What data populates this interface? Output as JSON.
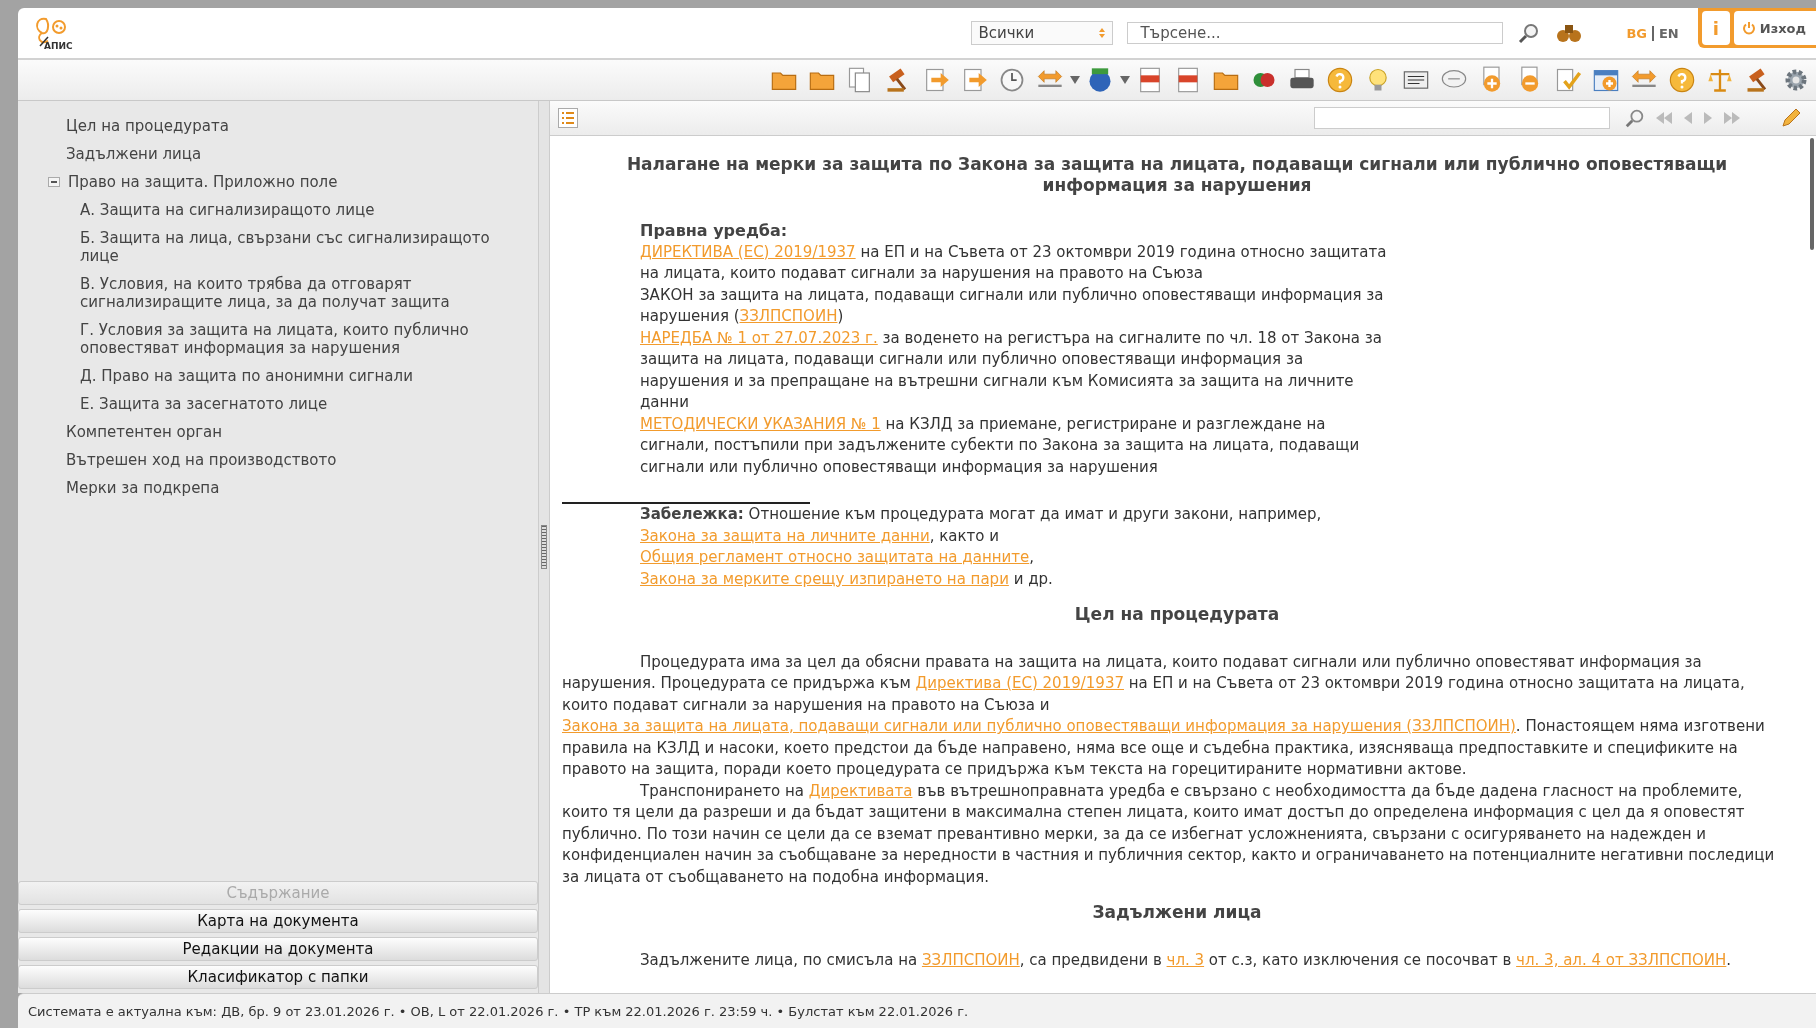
{
  "header": {
    "logo_text": "АПИС",
    "scope_select": "Всички",
    "search": {
      "placeholder": "Търсене..."
    },
    "languages": [
      {
        "label": "BG",
        "selected": true
      },
      {
        "label": "EN",
        "selected": false
      }
    ],
    "info_button": "i",
    "logout_button": "Изход"
  },
  "sidebar": {
    "outline": [
      {
        "label": "Цел на процедурата"
      },
      {
        "label": "Задължени лица"
      },
      {
        "label": "Право на защита. Приложно поле",
        "expanded": true,
        "children": [
          {
            "label": "А. Защита на сигнализиращото лице"
          },
          {
            "label": "Б. Защита на лица, свързани със сигнализиращото лице"
          },
          {
            "label": "В. Условия, на които трябва да отговарят сигнализиращите лица, за да получат защита"
          },
          {
            "label": "Г. Условия за защита на лицата, които публично оповестяват информация за нарушения"
          },
          {
            "label": "Д. Право на защита по анонимни сигнали"
          },
          {
            "label": "Е. Защита за засегнатото лице"
          }
        ]
      },
      {
        "label": "Компетентен орган"
      },
      {
        "label": "Вътрешен ход на производството"
      },
      {
        "label": "Мерки за подкрепа"
      }
    ],
    "panels": [
      {
        "label": "Съдържание",
        "selected": true
      },
      {
        "label": "Карта на документа",
        "selected": false
      },
      {
        "label": "Редакции на документа",
        "selected": false
      },
      {
        "label": "Класификатор с папки",
        "selected": false
      }
    ]
  },
  "document": {
    "title": "Налагане на мерки за защита по Закона за защита на лицата, подаващи сигнали или публично оповестяващи информация за нарушения",
    "legal_basis": {
      "heading": "Правна уредба:",
      "entries": [
        [
          {
            "text": "ДИРЕКТИВА (ЕС) 2019/1937",
            "link": true
          },
          {
            "text": " на ЕП и на Съвета от 23 октомври 2019 година относно защитата на лицата, които подават сигнали за нарушения на правото на Съюза",
            "link": false
          }
        ],
        [
          {
            "text": "ЗАКОН за защита на лицата, подаващи сигнали или публично оповестяващи информация за нарушения (",
            "link": false
          },
          {
            "text": "ЗЗЛПСПОИН",
            "link": true
          },
          {
            "text": ")",
            "link": false
          }
        ],
        [
          {
            "text": "НАРЕДБА № 1 от 27.07.2023 г.",
            "link": true
          },
          {
            "text": " за воденето на регистъра на сигналите по чл. 18 от Закона за защита на лицата, подаващи сигнали или публично оповестяващи информация за нарушения и за препращане на вътрешни сигнали към Комисията за защита на личните данни",
            "link": false
          }
        ],
        [
          {
            "text": "МЕТОДИЧЕСКИ УКАЗАНИЯ № 1",
            "link": true
          },
          {
            "text": " на КЗЛД за приемане, регистриране и разглеждане на сигнали, постъпили при задължените субекти по Закона за защита на лицата, подаващи сигнали или публично оповестяващи информация за нарушения",
            "link": false
          }
        ]
      ]
    },
    "note": {
      "label": "Забележка:",
      "segments": [
        {
          "text": " Отношение към процедурата могат да имат и други закони, например, ",
          "link": false
        },
        {
          "text": "Закона за защита на личните данни",
          "link": true
        },
        {
          "text": ", както и ",
          "link": false
        },
        {
          "text": "Общия регламент относно защитата на данните",
          "link": true
        },
        {
          "text": ", ",
          "link": false
        },
        {
          "text": "Закона за мерките срещу изпирането на пари",
          "link": true
        },
        {
          "text": " и др.",
          "link": false
        }
      ]
    },
    "sections": [
      {
        "heading": "Цел на процедурата",
        "paragraphs": [
          [
            {
              "text": "Процедурата има за цел да обясни правата на защита на лицата, които подават сигнали или публично оповестяват информация за нарушения. Процедурата се придържа към ",
              "link": false
            },
            {
              "text": "Директива (ЕС) 2019/1937",
              "link": true
            },
            {
              "text": " на ЕП и на Съвета от 23 октомври 2019 година относно защитата на лицата, които подават сигнали за нарушения на правото на Съюза и ",
              "link": false
            },
            {
              "text": "Закона за защита на лицата, подаващи сигнали или публично оповестяващи информация за нарушения (ЗЗЛПСПОИН)",
              "link": true
            },
            {
              "text": ". Понастоящем няма изготвени правила на КЗЛД и насоки, което предстои да бъде направено, няма все още и съдебна практика, изясняваща предпоставките и спецификите на правото на защита, поради което процедурата се придържа към текста на горецитираните нормативни актове.",
              "link": false
            }
          ],
          [
            {
              "text": "Транспонирането на ",
              "link": false
            },
            {
              "text": "Директивата",
              "link": true
            },
            {
              "text": " във вътрешноправната уредба е свързано с необходимостта да бъде дадена гласност на проблемите, които тя цели да разреши и да бъдат защитени в максимална степен лицата, които имат достъп до определена информация с цел да я оповестят публично. По този начин се цели да се вземат превантивно мерки, за да се избегнат усложненията, свързани с осигуряването на надежден и конфиденциален начин за съобщаване за нередности в частния и публичния сектор, както и ограничаването на потенциалните негативни последици за лицата от съобщаването на подобна информация.",
              "link": false
            }
          ]
        ]
      },
      {
        "heading": "Задължени лица",
        "paragraphs": [
          [
            {
              "text": "Задължените лица, по смисъла на ",
              "link": false
            },
            {
              "text": "ЗЗЛПСПОИН",
              "link": true
            },
            {
              "text": ", са предвидени в ",
              "link": false
            },
            {
              "text": "чл. 3",
              "link": true
            },
            {
              "text": " от с.з, като изключения се посочват в ",
              "link": false
            },
            {
              "text": "чл. 3, ал. 4 от ЗЗЛПСПОИН",
              "link": true
            },
            {
              "text": ".",
              "link": false
            }
          ]
        ]
      }
    ]
  },
  "status_bar": "Системата е актуална към: ДВ, бр. 9 от 23.01.2026 г. • OB, L от 22.01.2026 г. • ТР към 22.01.2026 г. 23:59 ч. • Булстат към 22.01.2026 г."
}
